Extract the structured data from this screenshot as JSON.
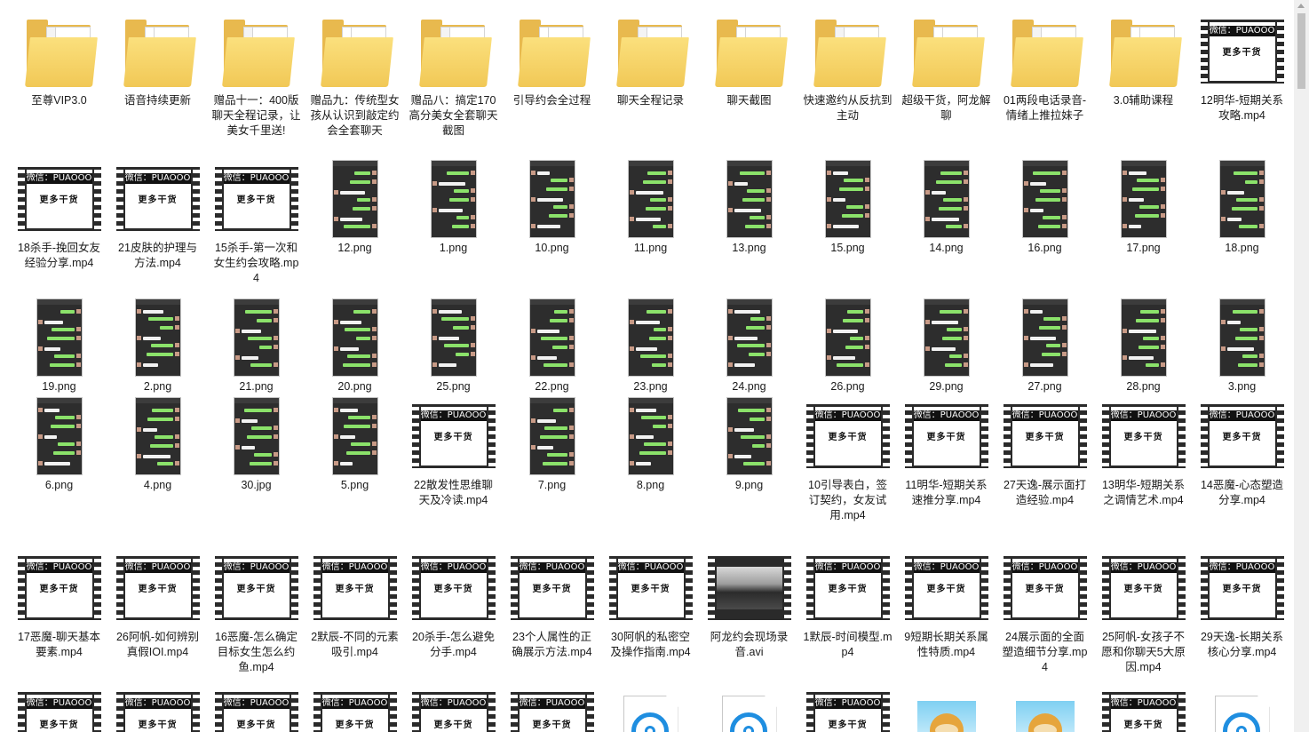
{
  "items": [
    {
      "label": "至尊VIP3.0",
      "type": "folder",
      "icon": "folder-icon"
    },
    {
      "label": "语音持续更新",
      "type": "folder",
      "icon": "folder-icon"
    },
    {
      "label": "赠品十一：400版聊天全程记录，让美女千里送!",
      "type": "folder",
      "icon": "folder-icon"
    },
    {
      "label": "赠品九：传统型女孩从认识到敲定约会全套聊天",
      "type": "folder",
      "icon": "folder-icon"
    },
    {
      "label": "赠品八：搞定170高分美女全套聊天截图",
      "type": "folder",
      "icon": "folder-icon"
    },
    {
      "label": "引导约会全过程",
      "type": "folder",
      "icon": "folder-icon"
    },
    {
      "label": "聊天全程记录",
      "type": "folder",
      "icon": "folder-icon"
    },
    {
      "label": "聊天截图",
      "type": "folder",
      "icon": "folder-icon"
    },
    {
      "label": "快速邀约从反抗到主动",
      "type": "folder",
      "icon": "folder-icon"
    },
    {
      "label": "超级干货，阿龙解聊",
      "type": "folder",
      "icon": "folder-icon"
    },
    {
      "label": "01两段电话录音-情绪上推拉妹子",
      "type": "folder",
      "icon": "folder-icon"
    },
    {
      "label": "3.0辅助课程",
      "type": "folder",
      "icon": "folder-icon"
    },
    {
      "label": "12明华-短期关系攻略.mp4",
      "type": "video",
      "icon": "video-icon"
    },
    {
      "label": "18杀手-挽回女友经验分享.mp4",
      "type": "video",
      "icon": "video-icon"
    },
    {
      "label": "21皮肤的护理与方法.mp4",
      "type": "video",
      "icon": "video-icon"
    },
    {
      "label": "15杀手-第一次和女生约会攻略.mp4",
      "type": "video",
      "icon": "video-icon"
    },
    {
      "label": "12.png",
      "type": "png",
      "icon": "image-icon"
    },
    {
      "label": "1.png",
      "type": "png",
      "icon": "image-icon"
    },
    {
      "label": "10.png",
      "type": "png",
      "icon": "image-icon"
    },
    {
      "label": "11.png",
      "type": "png",
      "icon": "image-icon"
    },
    {
      "label": "13.png",
      "type": "png",
      "icon": "image-icon"
    },
    {
      "label": "15.png",
      "type": "png",
      "icon": "image-icon"
    },
    {
      "label": "14.png",
      "type": "png",
      "icon": "image-icon"
    },
    {
      "label": "16.png",
      "type": "png",
      "icon": "image-icon"
    },
    {
      "label": "17.png",
      "type": "png",
      "icon": "image-icon"
    },
    {
      "label": "18.png",
      "type": "png",
      "icon": "image-icon"
    },
    {
      "label": "19.png",
      "type": "png",
      "icon": "image-icon"
    },
    {
      "label": "2.png",
      "type": "png",
      "icon": "image-icon"
    },
    {
      "label": "21.png",
      "type": "png",
      "icon": "image-icon"
    },
    {
      "label": "20.png",
      "type": "png",
      "icon": "image-icon"
    },
    {
      "label": "25.png",
      "type": "png",
      "icon": "image-icon"
    },
    {
      "label": "22.png",
      "type": "png",
      "icon": "image-icon"
    },
    {
      "label": "23.png",
      "type": "png",
      "icon": "image-icon"
    },
    {
      "label": "24.png",
      "type": "png",
      "icon": "image-icon"
    },
    {
      "label": "26.png",
      "type": "png",
      "icon": "image-icon"
    },
    {
      "label": "29.png",
      "type": "png",
      "icon": "image-icon"
    },
    {
      "label": "27.png",
      "type": "png",
      "icon": "image-icon"
    },
    {
      "label": "28.png",
      "type": "png",
      "icon": "image-icon"
    },
    {
      "label": "3.png",
      "type": "png",
      "icon": "image-icon"
    },
    {
      "label": "6.png",
      "type": "png",
      "icon": "image-icon"
    },
    {
      "label": "4.png",
      "type": "png",
      "icon": "image-icon"
    },
    {
      "label": "30.jpg",
      "type": "png",
      "icon": "image-icon"
    },
    {
      "label": "5.png",
      "type": "png",
      "icon": "image-icon"
    },
    {
      "label": "22散发性思维聊天及冷读.mp4",
      "type": "video",
      "icon": "video-icon"
    },
    {
      "label": "7.png",
      "type": "png",
      "icon": "image-icon"
    },
    {
      "label": "8.png",
      "type": "png",
      "icon": "image-icon"
    },
    {
      "label": "9.png",
      "type": "png",
      "icon": "image-icon"
    },
    {
      "label": "10引导表白，签订契约，女友试用.mp4",
      "type": "video",
      "icon": "video-icon"
    },
    {
      "label": "11明华-短期关系速推分享.mp4",
      "type": "video",
      "icon": "video-icon"
    },
    {
      "label": "27天逸-展示面打造经验.mp4",
      "type": "video",
      "icon": "video-icon"
    },
    {
      "label": "13明华-短期关系之调情艺术.mp4",
      "type": "video",
      "icon": "video-icon"
    },
    {
      "label": "14恶魔-心态塑造分享.mp4",
      "type": "video",
      "icon": "video-icon"
    },
    {
      "label": "17恶魔-聊天基本要素.mp4",
      "type": "video",
      "icon": "video-icon"
    },
    {
      "label": "26阿帆-如何辨别真假IOI.mp4",
      "type": "video",
      "icon": "video-icon"
    },
    {
      "label": "16恶魔-怎么确定目标女生怎么约鱼.mp4",
      "type": "video",
      "icon": "video-icon"
    },
    {
      "label": "2默辰-不同的元素吸引.mp4",
      "type": "video",
      "icon": "video-icon"
    },
    {
      "label": "20杀手-怎么避免分手.mp4",
      "type": "video",
      "icon": "video-icon"
    },
    {
      "label": "23个人属性的正确展示方法.mp4",
      "type": "video",
      "icon": "video-icon"
    },
    {
      "label": "30阿帆的私密空及操作指南.mp4",
      "type": "video",
      "icon": "video-icon"
    },
    {
      "label": "阿龙约会现场录音.avi",
      "type": "avi",
      "icon": "video-icon"
    },
    {
      "label": "1默辰-时间模型.mp4",
      "type": "video",
      "icon": "video-icon"
    },
    {
      "label": "9短期长期关系属性特质.mp4",
      "type": "video",
      "icon": "video-icon"
    },
    {
      "label": "24展示面的全面塑造细节分享.mp4",
      "type": "video",
      "icon": "video-icon"
    },
    {
      "label": "25阿帆-女孩子不愿和你聊天5大原因.mp4",
      "type": "video",
      "icon": "video-icon"
    },
    {
      "label": "29天逸-长期关系核心分享.mp4",
      "type": "video",
      "icon": "video-icon"
    },
    {
      "label": "",
      "type": "video",
      "icon": "video-icon"
    },
    {
      "label": "",
      "type": "video",
      "icon": "video-icon"
    },
    {
      "label": "",
      "type": "video",
      "icon": "video-icon"
    },
    {
      "label": "",
      "type": "video",
      "icon": "video-icon"
    },
    {
      "label": "",
      "type": "video",
      "icon": "video-icon"
    },
    {
      "label": "",
      "type": "video",
      "icon": "video-icon"
    },
    {
      "label": "",
      "type": "audio",
      "icon": "audio-file-icon"
    },
    {
      "label": "",
      "type": "audio",
      "icon": "audio-file-icon"
    },
    {
      "label": "",
      "type": "video",
      "icon": "video-icon"
    },
    {
      "label": "",
      "type": "mascot",
      "icon": "mascot-image-icon"
    },
    {
      "label": "",
      "type": "mascot",
      "icon": "mascot-image-icon"
    },
    {
      "label": "",
      "type": "video",
      "icon": "video-icon"
    },
    {
      "label": "",
      "type": "audio",
      "icon": "audio-file-icon"
    }
  ],
  "video_thumb": {
    "watermark": "微信：PUAOOO",
    "caption": "更多干货"
  },
  "colors": {
    "folder": "#f1c856",
    "chat_green": "#8be26a",
    "audio_blue": "#1f8ee0"
  }
}
